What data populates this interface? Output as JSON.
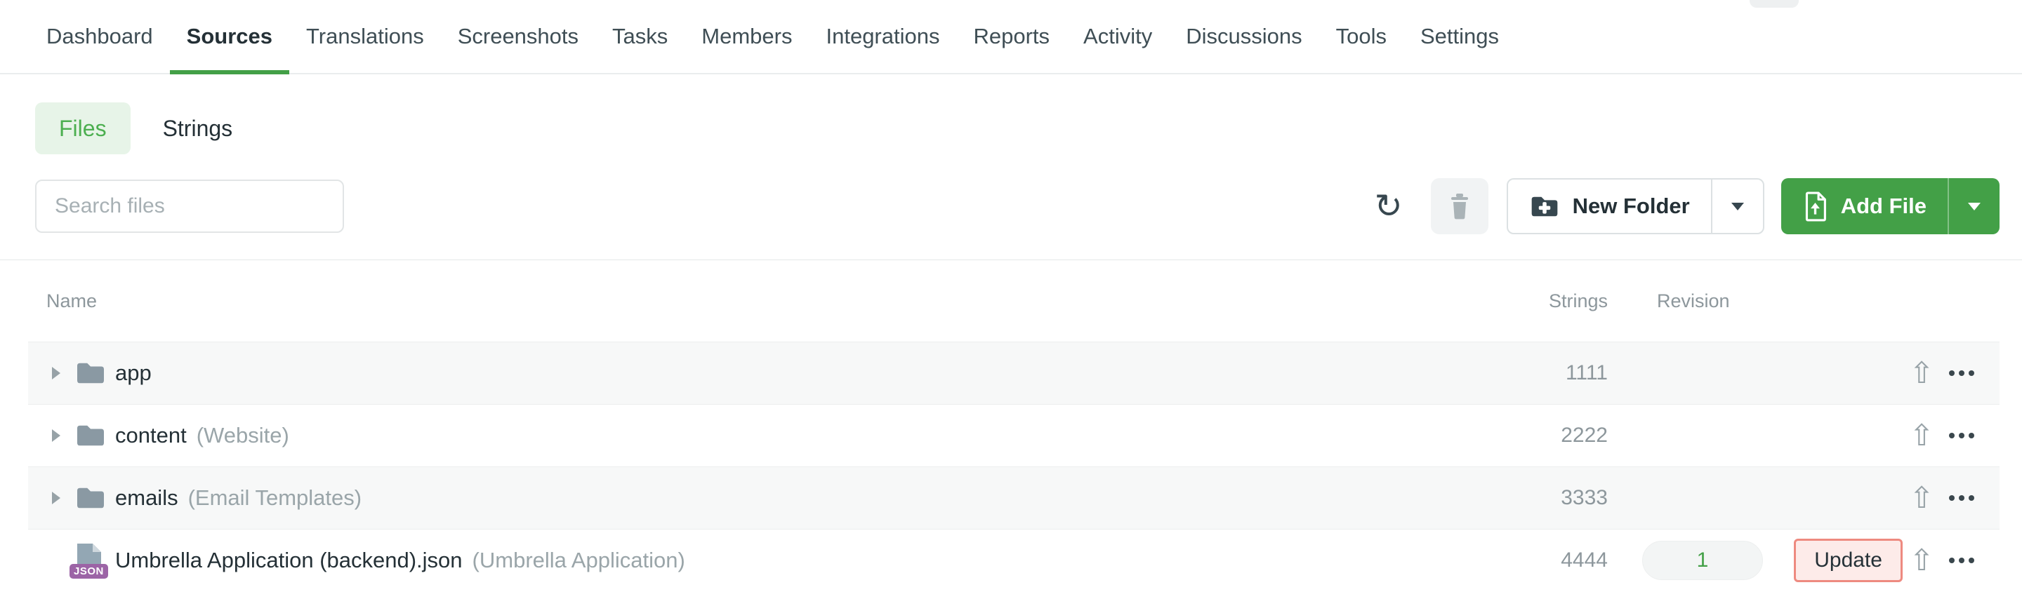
{
  "nav": {
    "tabs": [
      {
        "label": "Dashboard",
        "active": false
      },
      {
        "label": "Sources",
        "active": true
      },
      {
        "label": "Translations",
        "active": false
      },
      {
        "label": "Screenshots",
        "active": false
      },
      {
        "label": "Tasks",
        "active": false
      },
      {
        "label": "Members",
        "active": false
      },
      {
        "label": "Integrations",
        "active": false
      },
      {
        "label": "Reports",
        "active": false
      },
      {
        "label": "Activity",
        "active": false
      },
      {
        "label": "Discussions",
        "active": false
      },
      {
        "label": "Tools",
        "active": false
      },
      {
        "label": "Settings",
        "active": false
      }
    ]
  },
  "view_toggle": {
    "files_label": "Files",
    "strings_label": "Strings"
  },
  "toolbar": {
    "search_placeholder": "Search files",
    "refresh_glyph": "↻",
    "new_folder_label": "New Folder",
    "add_file_label": "Add File"
  },
  "table": {
    "headers": {
      "name": "Name",
      "strings": "Strings",
      "revision": "Revision"
    },
    "rows": [
      {
        "kind": "folder",
        "badge": "",
        "name": "app",
        "note": "",
        "strings": "1111",
        "revision": "",
        "update": ""
      },
      {
        "kind": "folder",
        "badge": "",
        "name": "content",
        "note": "(Website)",
        "strings": "2222",
        "revision": "",
        "update": ""
      },
      {
        "kind": "folder",
        "badge": "",
        "name": "emails",
        "note": "(Email Templates)",
        "strings": "3333",
        "revision": "",
        "update": ""
      },
      {
        "kind": "file",
        "badge": "JSON",
        "name": "Umbrella Application (backend).json",
        "note": "(Umbrella Application)",
        "strings": "4444",
        "revision": "1",
        "update": "Update"
      }
    ]
  },
  "icons": {
    "upload_glyph": "⇧"
  },
  "colors": {
    "accent_green": "#43a047",
    "files_pill_bg": "#e7f4e8",
    "files_pill_text": "#4caf50",
    "update_border": "#ee8a80",
    "update_bg": "#fdebe9",
    "json_badge": "#9c64a6",
    "revision_text": "#43a047"
  }
}
